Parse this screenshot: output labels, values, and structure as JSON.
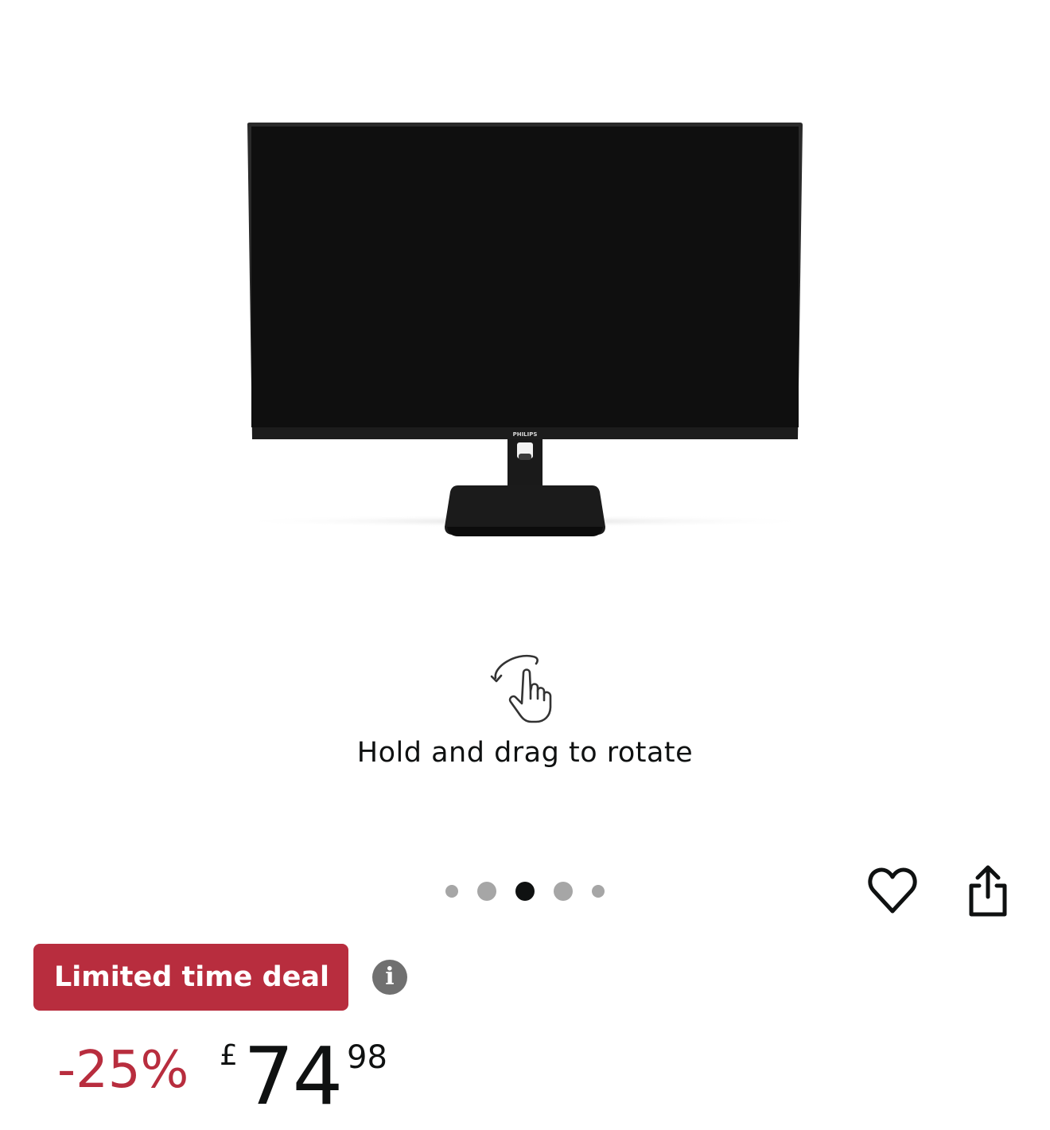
{
  "viewer": {
    "image_alt": "PHILIPS monitor",
    "brand_logo": "PHILIPS",
    "rotate_hint": "Hold and drag to rotate",
    "rotate_icon": "rotate-gesture-icon",
    "carousel": {
      "count": 5,
      "active_index": 2
    }
  },
  "actions": {
    "wishlist_icon": "heart-icon",
    "share_icon": "share-icon"
  },
  "deal": {
    "badge": "Limited time deal",
    "info_icon": "i"
  },
  "price": {
    "discount": "-25%",
    "currency": "£",
    "whole": "74",
    "fraction": "98"
  },
  "colors": {
    "deal_red": "#b82d3e",
    "text": "#0f1111",
    "dot_inactive": "#a6a6a6",
    "dot_active": "#0f1111",
    "info_gray": "#707070"
  }
}
